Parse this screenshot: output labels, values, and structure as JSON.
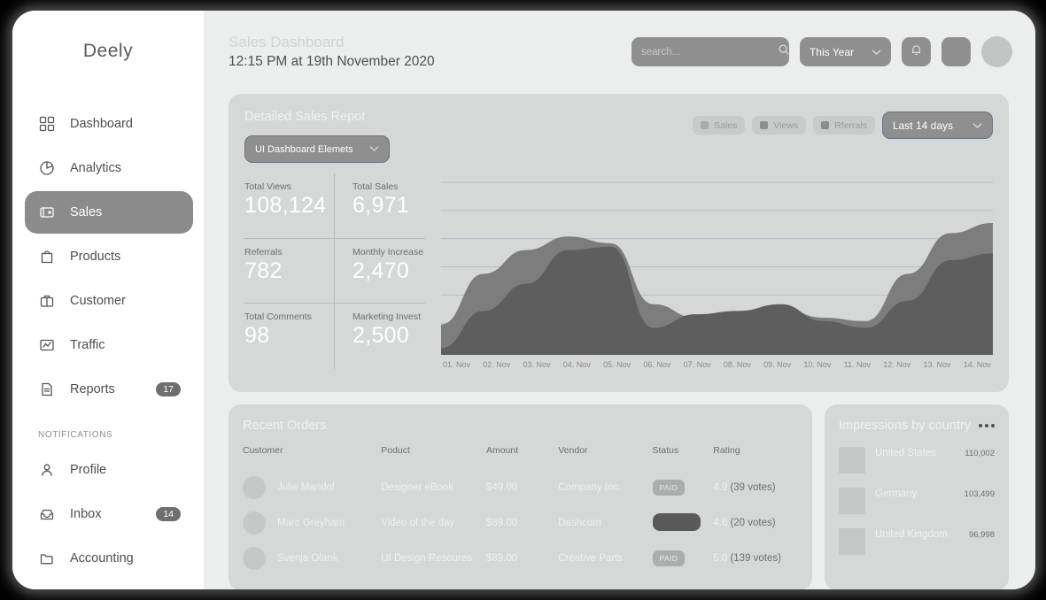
{
  "brand": "Deely",
  "sidebar": {
    "items": [
      {
        "label": "Dashboard",
        "icon": "grid-icon",
        "badge": ""
      },
      {
        "label": "Analytics",
        "icon": "pie-chart-icon",
        "badge": ""
      },
      {
        "label": "Sales",
        "icon": "wallet-icon",
        "badge": ""
      },
      {
        "label": "Products",
        "icon": "shopping-bag-icon",
        "badge": ""
      },
      {
        "label": "Customer",
        "icon": "briefcase-icon",
        "badge": ""
      },
      {
        "label": "Traffic",
        "icon": "chart-icon",
        "badge": ""
      },
      {
        "label": "Reports",
        "icon": "document-icon",
        "badge": "17"
      }
    ],
    "section_label": "NOTIFICATIONS",
    "notification_items": [
      {
        "label": "Profile",
        "icon": "user-icon",
        "badge": ""
      },
      {
        "label": "Inbox",
        "icon": "inbox-icon",
        "badge": "14"
      },
      {
        "label": "Accounting",
        "icon": "folder-icon",
        "badge": ""
      }
    ]
  },
  "header": {
    "title": "Sales Dashboard",
    "subtitle": "12:15 PM at 19th November 2020",
    "search_placeholder": "search...",
    "search_value": "",
    "period_select": "This Year"
  },
  "report": {
    "title": "Detailed Sales Repot",
    "element_select": "UI Dashboard Elemets",
    "legend": [
      "Sales",
      "Views",
      "Rferrals"
    ],
    "range_select": "Last 14 days",
    "stats": [
      {
        "label": "Total Views",
        "value": "108,124"
      },
      {
        "label": "Total Sales",
        "value": "6,971"
      },
      {
        "label": "Referrals",
        "value": "782"
      },
      {
        "label": "Monthly Increase",
        "value": "2,470"
      },
      {
        "label": "Total Comments",
        "value": "98"
      },
      {
        "label": "Marketing Invest",
        "value": "2,500"
      }
    ]
  },
  "chart_data": {
    "type": "area",
    "title": "Detailed Sales Repot",
    "xlabel": "",
    "ylabel": "",
    "grid": true,
    "gridlines": 6,
    "legend": [
      "Sales",
      "Views",
      "Rferrals"
    ],
    "legend_position": "top-right",
    "categories": [
      "01. Nov",
      "02. Nov",
      "03. Nov",
      "04. Nov",
      "05. Nov",
      "06. Nov",
      "07. Nov",
      "08. Nov",
      "09. Nov",
      "10. Nov",
      "11. Nov",
      "12. Nov",
      "13. Nov",
      "14. Nov"
    ],
    "ylim": [
      0,
      100
    ],
    "series": [
      {
        "name": "Views",
        "values": [
          18,
          48,
          62,
          70,
          66,
          30,
          22,
          24,
          28,
          22,
          20,
          48,
          72,
          78
        ]
      },
      {
        "name": "Sales",
        "values": [
          4,
          26,
          42,
          62,
          64,
          16,
          24,
          26,
          30,
          20,
          16,
          32,
          56,
          60
        ]
      }
    ]
  },
  "orders": {
    "title": "Recent Orders",
    "columns": [
      "Customer",
      "Poduct",
      "Amount",
      "Vendor",
      "Status",
      "Rating"
    ],
    "rows": [
      {
        "customer": "Julie Mandol",
        "product": "Designer eBook",
        "amount": "$49.00",
        "vendor": "Company Inc.",
        "status": "PAID",
        "rating": "4.9",
        "votes": "(39 votes)"
      },
      {
        "customer": "Marc Greyham",
        "product": "Video of the day",
        "amount": "$89.00",
        "vendor": "Dashcom",
        "status": "",
        "rating": "4.6",
        "votes": "(20 votes)"
      },
      {
        "customer": "Svenja Olank",
        "product": "UI Design Resoures",
        "amount": "$89.00",
        "vendor": "Creative Parts",
        "status": "PAID",
        "rating": "5.0",
        "votes": "(139 votes)"
      }
    ]
  },
  "countries": {
    "title": "Impressions by country",
    "rows": [
      {
        "name": "United States",
        "value": "110,002",
        "fill": 78
      },
      {
        "name": "Germany",
        "value": "103,499",
        "fill": 60
      },
      {
        "name": "United Kingdom",
        "value": "96,998",
        "fill": 0
      }
    ]
  },
  "colors": {
    "page_bg": "#000000",
    "window_bg": "#ffffff",
    "content_bg": "#eceded",
    "card_bg": "#d6d7d7",
    "accent": "#8f8f8f",
    "active_nav": "#8b8b8b"
  }
}
